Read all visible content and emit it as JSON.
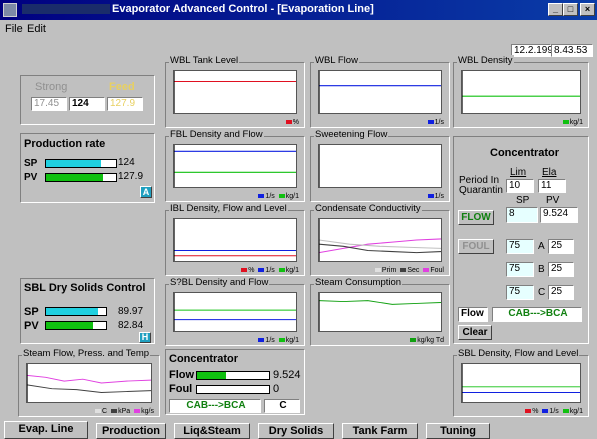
{
  "window": {
    "title": "Evaporator Advanced Control - [Evaporation Line]"
  },
  "winbuttons": {
    "minimize": "_",
    "maximize": "□",
    "close": "×"
  },
  "menu": [
    {
      "label": "File"
    },
    {
      "label": "Edit"
    }
  ],
  "clock": {
    "date": "12.2.1996",
    "time": "8.43.53"
  },
  "strong": {
    "label": "Strong",
    "label_feed": "Feed",
    "v1": "17.45",
    "v2": "124",
    "v3": "127.9"
  },
  "production": {
    "title": "Production rate",
    "sp_label": "SP",
    "pv_label": "PV",
    "sp_value": "124",
    "pv_value": "127.9",
    "sp_level": 0.78,
    "pv_level": 0.82,
    "button": "A"
  },
  "sbl_dry": {
    "title": "SBL Dry Solids Control",
    "sp_label": "SP",
    "pv_label": "PV",
    "sp_value": "89.97",
    "pv_value": "82.84",
    "sp_level": 0.86,
    "pv_level": 0.78,
    "button": "H"
  },
  "charts": {
    "wbl_tank": {
      "title": "WBL Tank Level",
      "legend": "%"
    },
    "wbl_flow": {
      "title": "WBL Flow",
      "legend": "1/s"
    },
    "wbl_density": {
      "title": "WBL Density",
      "legend": "kg/1"
    },
    "fbl": {
      "title": "FBL Density and Flow",
      "legend1": "1/s",
      "legend2": "kg/1"
    },
    "sweetening": {
      "title": "Sweetening Flow",
      "legend": "1/s"
    },
    "ibl": {
      "title": "IBL Density, Flow and Level",
      "legend1": "%",
      "legend2": "1/s",
      "legend3": "kg/1"
    },
    "condensate": {
      "title": "Condensate Conductivity",
      "legend1": "Prim",
      "legend2": "Sec",
      "legend3": "Foul"
    },
    "s2bl": {
      "title": "S?BL Density and Flow",
      "legend1": "1/s",
      "legend2": "kg/1"
    },
    "steam_cons": {
      "title": "Steam Consumption",
      "legend": "kg/kg Td"
    },
    "steam_flow": {
      "title": "Steam Flow, Press. and Temp",
      "legend1": "C",
      "legend2": "kPa",
      "legend3": "kg/s"
    },
    "sbl": {
      "title": "SBL Density, Flow and Level",
      "legend1": "%",
      "legend2": "1/s",
      "legend3": "kg/1"
    }
  },
  "concentrator_right": {
    "title": "Concentrator",
    "period_label": "Period In",
    "quarantine_label": "Quarantin",
    "lim_label": "Lim",
    "ela_label": "Ela",
    "lim_value": "10",
    "ela_value": "11",
    "sp_label": "SP",
    "pv_label": "PV",
    "flow_button": "FLOW",
    "flow_sp": "8",
    "flow_pv": "9.524",
    "foul_button": "FOUL",
    "rows": [
      {
        "sp": "75",
        "letter": "A",
        "pv": "25"
      },
      {
        "sp": "75",
        "letter": "B",
        "pv": "25"
      },
      {
        "sp": "75",
        "letter": "C",
        "pv": "25"
      }
    ],
    "flow_label": "Flow",
    "direction": "CAB--->BCA",
    "clear_button": "Clear"
  },
  "concentrator_bottom": {
    "title": "Concentrator",
    "flow_label": "Flow",
    "flow_value": "9.524",
    "flow_level": 0.4,
    "foul_label": "Foul",
    "foul_value": "0",
    "direction": "CAB--->BCA",
    "letter": "C"
  },
  "tabs": [
    {
      "label": "Evap. Line"
    },
    {
      "label": "Production"
    },
    {
      "label": "Liq&Steam"
    },
    {
      "label": "Dry Solids"
    },
    {
      "label": "Tank Farm"
    },
    {
      "label": "Tuning"
    }
  ],
  "colors": {
    "red": "#e01020",
    "blue": "#1020e0",
    "green": "#10c010",
    "magenta": "#e040e0",
    "grey": "#a0a0a0",
    "cyan": "#20d0e0"
  }
}
